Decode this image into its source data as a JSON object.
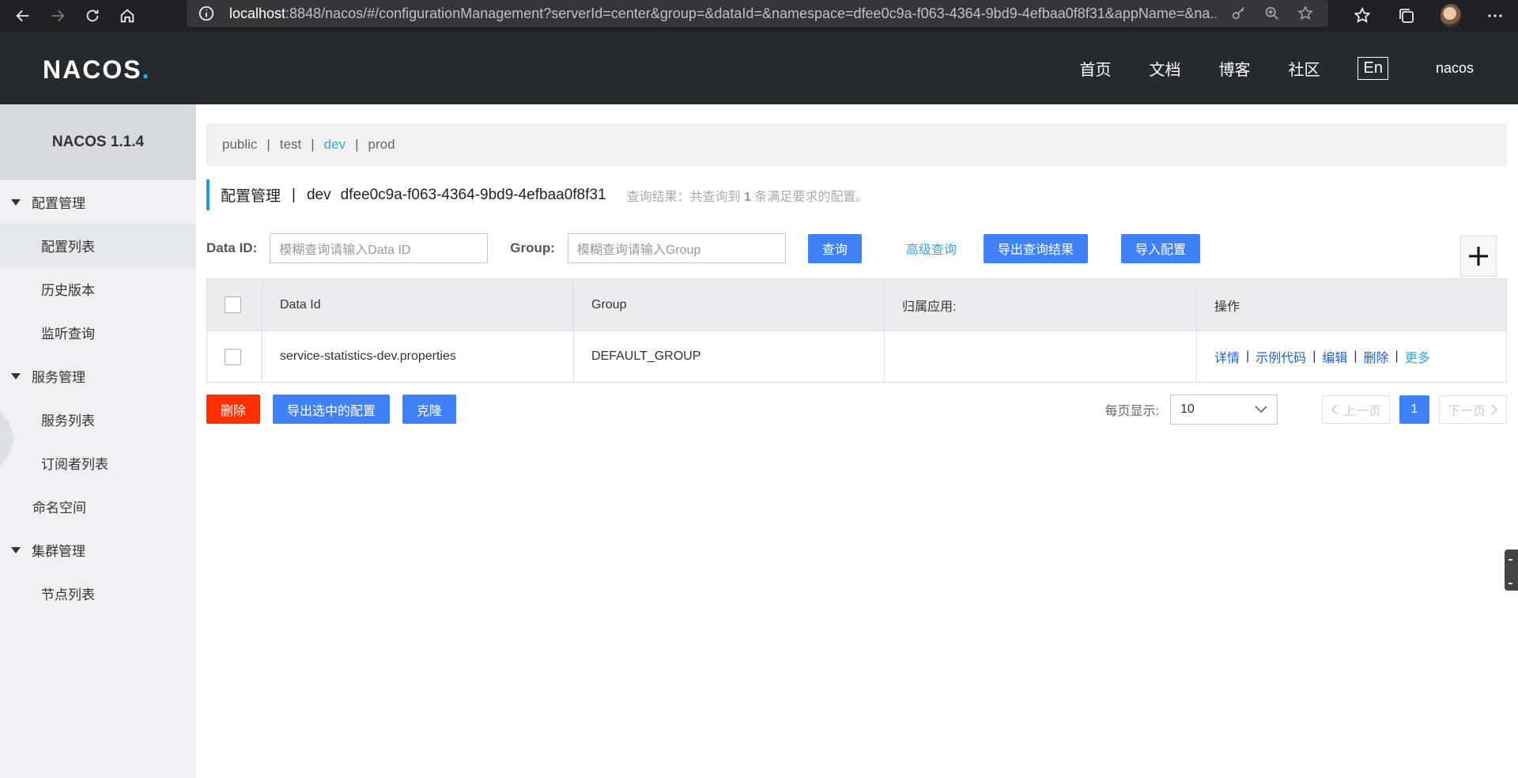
{
  "browser": {
    "url_host": "localhost",
    "url_rest": ":8848/nacos/#/configurationManagement?serverId=center&group=&dataId=&namespace=dfee0c9a-f063-4364-9bd9-4efbaa0f8f31&appName=&na..."
  },
  "header": {
    "logo_text": "NACOS",
    "logo_dot": ".",
    "nav": [
      "首页",
      "文档",
      "博客",
      "社区"
    ],
    "lang": "En",
    "user": "nacos"
  },
  "sidebar": {
    "version": "NACOS 1.1.4",
    "groups": [
      {
        "label": "配置管理",
        "items": [
          "配置列表",
          "历史版本",
          "监听查询"
        ]
      },
      {
        "label": "服务管理",
        "items": [
          "服务列表",
          "订阅者列表"
        ]
      },
      {
        "plain": "命名空间"
      },
      {
        "label": "集群管理",
        "items": [
          "节点列表"
        ]
      }
    ]
  },
  "namespaces": {
    "items": [
      "public",
      "test",
      "dev",
      "prod"
    ],
    "active": "dev",
    "separator": "|"
  },
  "title": {
    "main": "配置管理",
    "sep": "|",
    "ns_name": "dev",
    "ns_id": "dfee0c9a-f063-4364-9bd9-4efbaa0f8f31",
    "result_prefix": "查询结果：共查询到",
    "result_count": "1",
    "result_suffix": "条满足要求的配置。"
  },
  "search": {
    "dataid_label": "Data ID:",
    "dataid_placeholder": "模糊查询请输入Data ID",
    "group_label": "Group:",
    "group_placeholder": "模糊查询请输入Group",
    "query_btn": "查询",
    "advanced": "高级查询",
    "export_btn": "导出查询结果",
    "import_btn": "导入配置"
  },
  "table": {
    "headers": [
      "Data Id",
      "Group",
      "归属应用:",
      "操作"
    ],
    "rows": [
      {
        "data_id": "service-statistics-dev.properties",
        "group": "DEFAULT_GROUP",
        "app": "",
        "ops": [
          "详情",
          "示例代码",
          "编辑",
          "删除",
          "更多"
        ]
      }
    ],
    "op_sep": "|"
  },
  "bottom": {
    "delete_btn": "删除",
    "export_selected_btn": "导出选中的配置",
    "clone_btn": "克隆"
  },
  "pager": {
    "page_size_label": "每页显示:",
    "page_size": "10",
    "prev": "上一页",
    "next": "下一页",
    "current_page": "1"
  },
  "colors": {
    "header_bg": "#252a2f",
    "accent": "#3f82f7",
    "danger": "#ff3000",
    "link": "#33a7e1"
  }
}
